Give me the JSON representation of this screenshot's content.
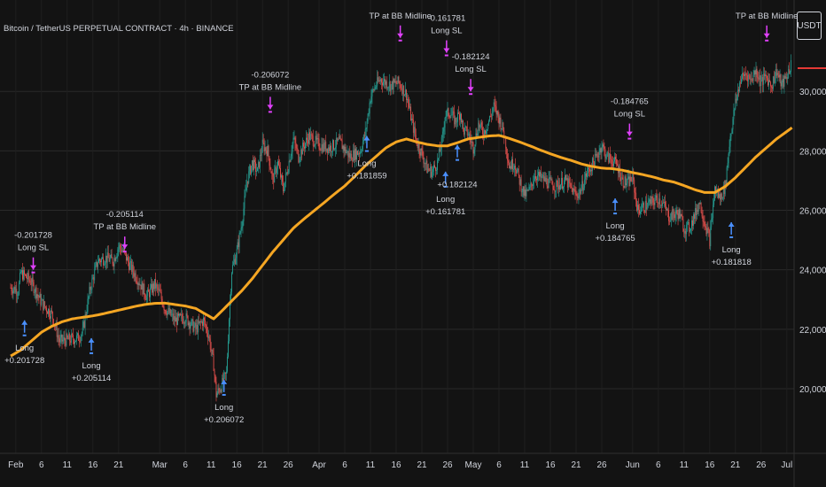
{
  "chart_title": "Bitcoin / TetherUS PERPETUAL CONTRACT · 4h · BINANCE",
  "currency_badge": "USDT",
  "colors": {
    "background": "#131313",
    "up": "#26a69a",
    "down": "#ef5350",
    "ma": "#f5a623",
    "long": "#4a90ff",
    "exit": "#e040fb",
    "text": "#d1d4dc"
  },
  "chart_data": {
    "type": "candlestick",
    "interval": "4h",
    "ylim": [
      19200,
      33600
    ],
    "y_ticks": [
      "20,000.0",
      "22,000.0",
      "24,000.0",
      "26,000.0",
      "28,000.0",
      "30,000.0"
    ],
    "y_tick_values": [
      20000,
      22000,
      24000,
      26000,
      28000,
      30000
    ],
    "x_ticks": [
      {
        "day": 1,
        "label": "Feb"
      },
      {
        "day": 6,
        "label": "6"
      },
      {
        "day": 11,
        "label": "11"
      },
      {
        "day": 16,
        "label": "16"
      },
      {
        "day": 21,
        "label": "21"
      },
      {
        "day": 29,
        "label": "Mar"
      },
      {
        "day": 34,
        "label": "6"
      },
      {
        "day": 39,
        "label": "11"
      },
      {
        "day": 44,
        "label": "16"
      },
      {
        "day": 49,
        "label": "21"
      },
      {
        "day": 54,
        "label": "26"
      },
      {
        "day": 60,
        "label": "Apr"
      },
      {
        "day": 65,
        "label": "6"
      },
      {
        "day": 70,
        "label": "11"
      },
      {
        "day": 75,
        "label": "16"
      },
      {
        "day": 80,
        "label": "21"
      },
      {
        "day": 85,
        "label": "26"
      },
      {
        "day": 90,
        "label": "May"
      },
      {
        "day": 95,
        "label": "6"
      },
      {
        "day": 100,
        "label": "11"
      },
      {
        "day": 105,
        "label": "16"
      },
      {
        "day": 110,
        "label": "21"
      },
      {
        "day": 115,
        "label": "26"
      },
      {
        "day": 121,
        "label": "Jun"
      },
      {
        "day": 126,
        "label": "6"
      },
      {
        "day": 131,
        "label": "11"
      },
      {
        "day": 136,
        "label": "16"
      },
      {
        "day": 141,
        "label": "21"
      },
      {
        "day": 146,
        "label": "26"
      },
      {
        "day": 151,
        "label": "Jul"
      }
    ],
    "price_anchors": [
      [
        0,
        23400
      ],
      [
        1.5,
        23300
      ],
      [
        2,
        23900
      ],
      [
        4,
        23600
      ],
      [
        6,
        22900
      ],
      [
        8,
        22500
      ],
      [
        9.5,
        21600
      ],
      [
        13,
        21700
      ],
      [
        14,
        21900
      ],
      [
        15.5,
        23400
      ],
      [
        17,
        24300
      ],
      [
        18.5,
        24400
      ],
      [
        20,
        24300
      ],
      [
        21,
        24800
      ],
      [
        22,
        24600
      ],
      [
        23,
        24200
      ],
      [
        25,
        23600
      ],
      [
        26.5,
        23100
      ],
      [
        28,
        23500
      ],
      [
        29,
        23200
      ],
      [
        30,
        22700
      ],
      [
        32,
        22300
      ],
      [
        34,
        22400
      ],
      [
        36,
        22000
      ],
      [
        37.5,
        22300
      ],
      [
        38.5,
        21800
      ],
      [
        39.5,
        20800
      ],
      [
        40,
        19800
      ],
      [
        41,
        20100
      ],
      [
        42,
        20500
      ],
      [
        42.5,
        22400
      ],
      [
        43,
        24000
      ],
      [
        44,
        24600
      ],
      [
        45,
        25600
      ],
      [
        46,
        27000
      ],
      [
        47,
        27600
      ],
      [
        48,
        27300
      ],
      [
        49,
        28200
      ],
      [
        50,
        28000
      ],
      [
        51,
        27000
      ],
      [
        52,
        27600
      ],
      [
        53,
        26700
      ],
      [
        54,
        27500
      ],
      [
        55,
        28400
      ],
      [
        56,
        27800
      ],
      [
        58,
        28500
      ],
      [
        60,
        28200
      ],
      [
        62,
        28100
      ],
      [
        64,
        28300
      ],
      [
        66,
        27800
      ],
      [
        68,
        28000
      ],
      [
        69,
        28600
      ],
      [
        70,
        29800
      ],
      [
        71,
        30200
      ],
      [
        72,
        30400
      ],
      [
        74,
        30200
      ],
      [
        75.5,
        30300
      ],
      [
        77,
        29900
      ],
      [
        78,
        29000
      ],
      [
        79,
        28300
      ],
      [
        80,
        27900
      ],
      [
        81,
        27400
      ],
      [
        82,
        27300
      ],
      [
        83,
        27600
      ],
      [
        84,
        28400
      ],
      [
        84.5,
        29200
      ],
      [
        85.5,
        29300
      ],
      [
        86.5,
        29000
      ],
      [
        87.5,
        29300
      ],
      [
        88,
        28700
      ],
      [
        89,
        28600
      ],
      [
        90,
        28100
      ],
      [
        91,
        28900
      ],
      [
        92,
        28600
      ],
      [
        93,
        29000
      ],
      [
        94,
        29500
      ],
      [
        95,
        29100
      ],
      [
        96,
        28600
      ],
      [
        97,
        27500
      ],
      [
        98,
        27600
      ],
      [
        99,
        27000
      ],
      [
        100,
        26500
      ],
      [
        101,
        26700
      ],
      [
        102,
        27200
      ],
      [
        104,
        27000
      ],
      [
        106,
        26800
      ],
      [
        108,
        27000
      ],
      [
        110,
        26500
      ],
      [
        111,
        26700
      ],
      [
        112,
        27200
      ],
      [
        113,
        27500
      ],
      [
        114,
        27800
      ],
      [
        115,
        28200
      ],
      [
        116,
        27800
      ],
      [
        117,
        27700
      ],
      [
        118,
        27500
      ],
      [
        119,
        27000
      ],
      [
        120,
        26900
      ],
      [
        121,
        27100
      ],
      [
        122,
        26000
      ],
      [
        124,
        26200
      ],
      [
        126,
        26400
      ],
      [
        127,
        26200
      ],
      [
        128,
        25800
      ],
      [
        130,
        25900
      ],
      [
        131,
        25400
      ],
      [
        132,
        25400
      ],
      [
        133,
        25800
      ],
      [
        134,
        26300
      ],
      [
        135,
        25600
      ],
      [
        136,
        25000
      ],
      [
        137,
        26700
      ],
      [
        138,
        26400
      ],
      [
        139,
        26800
      ],
      [
        140,
        28500
      ],
      [
        141,
        29600
      ],
      [
        142,
        30400
      ],
      [
        143,
        30600
      ],
      [
        144,
        30400
      ],
      [
        145,
        30700
      ],
      [
        146,
        30300
      ],
      [
        147,
        30500
      ],
      [
        148,
        30200
      ],
      [
        149,
        30700
      ],
      [
        150,
        30200
      ],
      [
        151,
        30500
      ],
      [
        152,
        31000
      ]
    ],
    "ma_anchors": [
      [
        0,
        21100
      ],
      [
        2,
        21300
      ],
      [
        4,
        21600
      ],
      [
        6,
        21900
      ],
      [
        8,
        22100
      ],
      [
        10,
        22250
      ],
      [
        12,
        22350
      ],
      [
        14,
        22400
      ],
      [
        16,
        22450
      ],
      [
        18,
        22520
      ],
      [
        20,
        22600
      ],
      [
        22,
        22680
      ],
      [
        24,
        22760
      ],
      [
        26,
        22830
      ],
      [
        28,
        22870
      ],
      [
        30,
        22880
      ],
      [
        32,
        22830
      ],
      [
        34,
        22780
      ],
      [
        36,
        22700
      ],
      [
        38,
        22500
      ],
      [
        39.5,
        22350
      ],
      [
        41,
        22600
      ],
      [
        43,
        22950
      ],
      [
        45,
        23300
      ],
      [
        47,
        23700
      ],
      [
        49,
        24150
      ],
      [
        51,
        24600
      ],
      [
        53,
        25000
      ],
      [
        55,
        25400
      ],
      [
        57,
        25700
      ],
      [
        59,
        25980
      ],
      [
        61,
        26260
      ],
      [
        63,
        26550
      ],
      [
        65,
        26820
      ],
      [
        67,
        27150
      ],
      [
        69,
        27500
      ],
      [
        71,
        27800
      ],
      [
        73,
        28100
      ],
      [
        75,
        28300
      ],
      [
        77,
        28400
      ],
      [
        79,
        28300
      ],
      [
        81,
        28220
      ],
      [
        83,
        28170
      ],
      [
        85,
        28170
      ],
      [
        87,
        28280
      ],
      [
        89,
        28400
      ],
      [
        91,
        28450
      ],
      [
        93,
        28500
      ],
      [
        95,
        28520
      ],
      [
        97,
        28420
      ],
      [
        99,
        28300
      ],
      [
        101,
        28170
      ],
      [
        103,
        28030
      ],
      [
        105,
        27900
      ],
      [
        107,
        27780
      ],
      [
        109,
        27680
      ],
      [
        111,
        27560
      ],
      [
        113,
        27480
      ],
      [
        115,
        27420
      ],
      [
        117,
        27400
      ],
      [
        119,
        27350
      ],
      [
        121,
        27270
      ],
      [
        123,
        27200
      ],
      [
        125,
        27120
      ],
      [
        127,
        27020
      ],
      [
        129,
        26950
      ],
      [
        131,
        26830
      ],
      [
        133,
        26700
      ],
      [
        135,
        26600
      ],
      [
        137,
        26600
      ],
      [
        139,
        26800
      ],
      [
        141,
        27100
      ],
      [
        143,
        27450
      ],
      [
        145,
        27800
      ],
      [
        147,
        28100
      ],
      [
        149,
        28400
      ],
      [
        151,
        28650
      ],
      [
        152,
        28780
      ]
    ],
    "annotations": [
      {
        "type": "entry",
        "day": 2.7,
        "price": 22300,
        "text1": "Long",
        "text2": "+0.201728"
      },
      {
        "type": "exit",
        "day": 4.4,
        "price": 24000,
        "text1": "-0.201728",
        "text2": "Long SL"
      },
      {
        "type": "entry",
        "day": 15.7,
        "price": 21700,
        "text1": "Long",
        "text2": "+0.205114"
      },
      {
        "type": "exit",
        "day": 22.2,
        "price": 24700,
        "text1": "-0.205114",
        "text2": "TP at BB Midline"
      },
      {
        "type": "entry",
        "day": 41.5,
        "price": 20300,
        "text1": "Long",
        "text2": "+0.206072"
      },
      {
        "type": "exit",
        "day": 50.5,
        "price": 29400,
        "text1": "-0.206072",
        "text2": "TP at BB Midline"
      },
      {
        "type": "entry",
        "day": 69.3,
        "price": 28500,
        "text1": "Long",
        "text2": "+0.181859"
      },
      {
        "type": "exit",
        "day": 75.8,
        "price": 31800,
        "text1": "TP at BB Midline",
        "text2": ""
      },
      {
        "type": "entry",
        "day": 84.6,
        "price": 27300,
        "text1": "Long",
        "text2": "+0.161781"
      },
      {
        "type": "entry",
        "day": 86.9,
        "price": 28200,
        "text1": "",
        "text2": "+0.182124"
      },
      {
        "type": "exit",
        "day": 84.8,
        "price": 31300,
        "text1": "-0.161781",
        "text2": "Long SL"
      },
      {
        "type": "exit",
        "day": 89.5,
        "price": 30000,
        "text1": "-0.182124",
        "text2": "Long SL"
      },
      {
        "type": "entry",
        "day": 117.6,
        "price": 26400,
        "text1": "Long",
        "text2": "+0.184765"
      },
      {
        "type": "exit",
        "day": 120.4,
        "price": 28500,
        "text1": "-0.184765",
        "text2": "Long SL"
      },
      {
        "type": "entry",
        "day": 140.2,
        "price": 25600,
        "text1": "Long",
        "text2": "+0.181818"
      },
      {
        "type": "exit",
        "day": 147.1,
        "price": 31800,
        "text1": "TP at BB Midline",
        "text2": ""
      }
    ]
  }
}
